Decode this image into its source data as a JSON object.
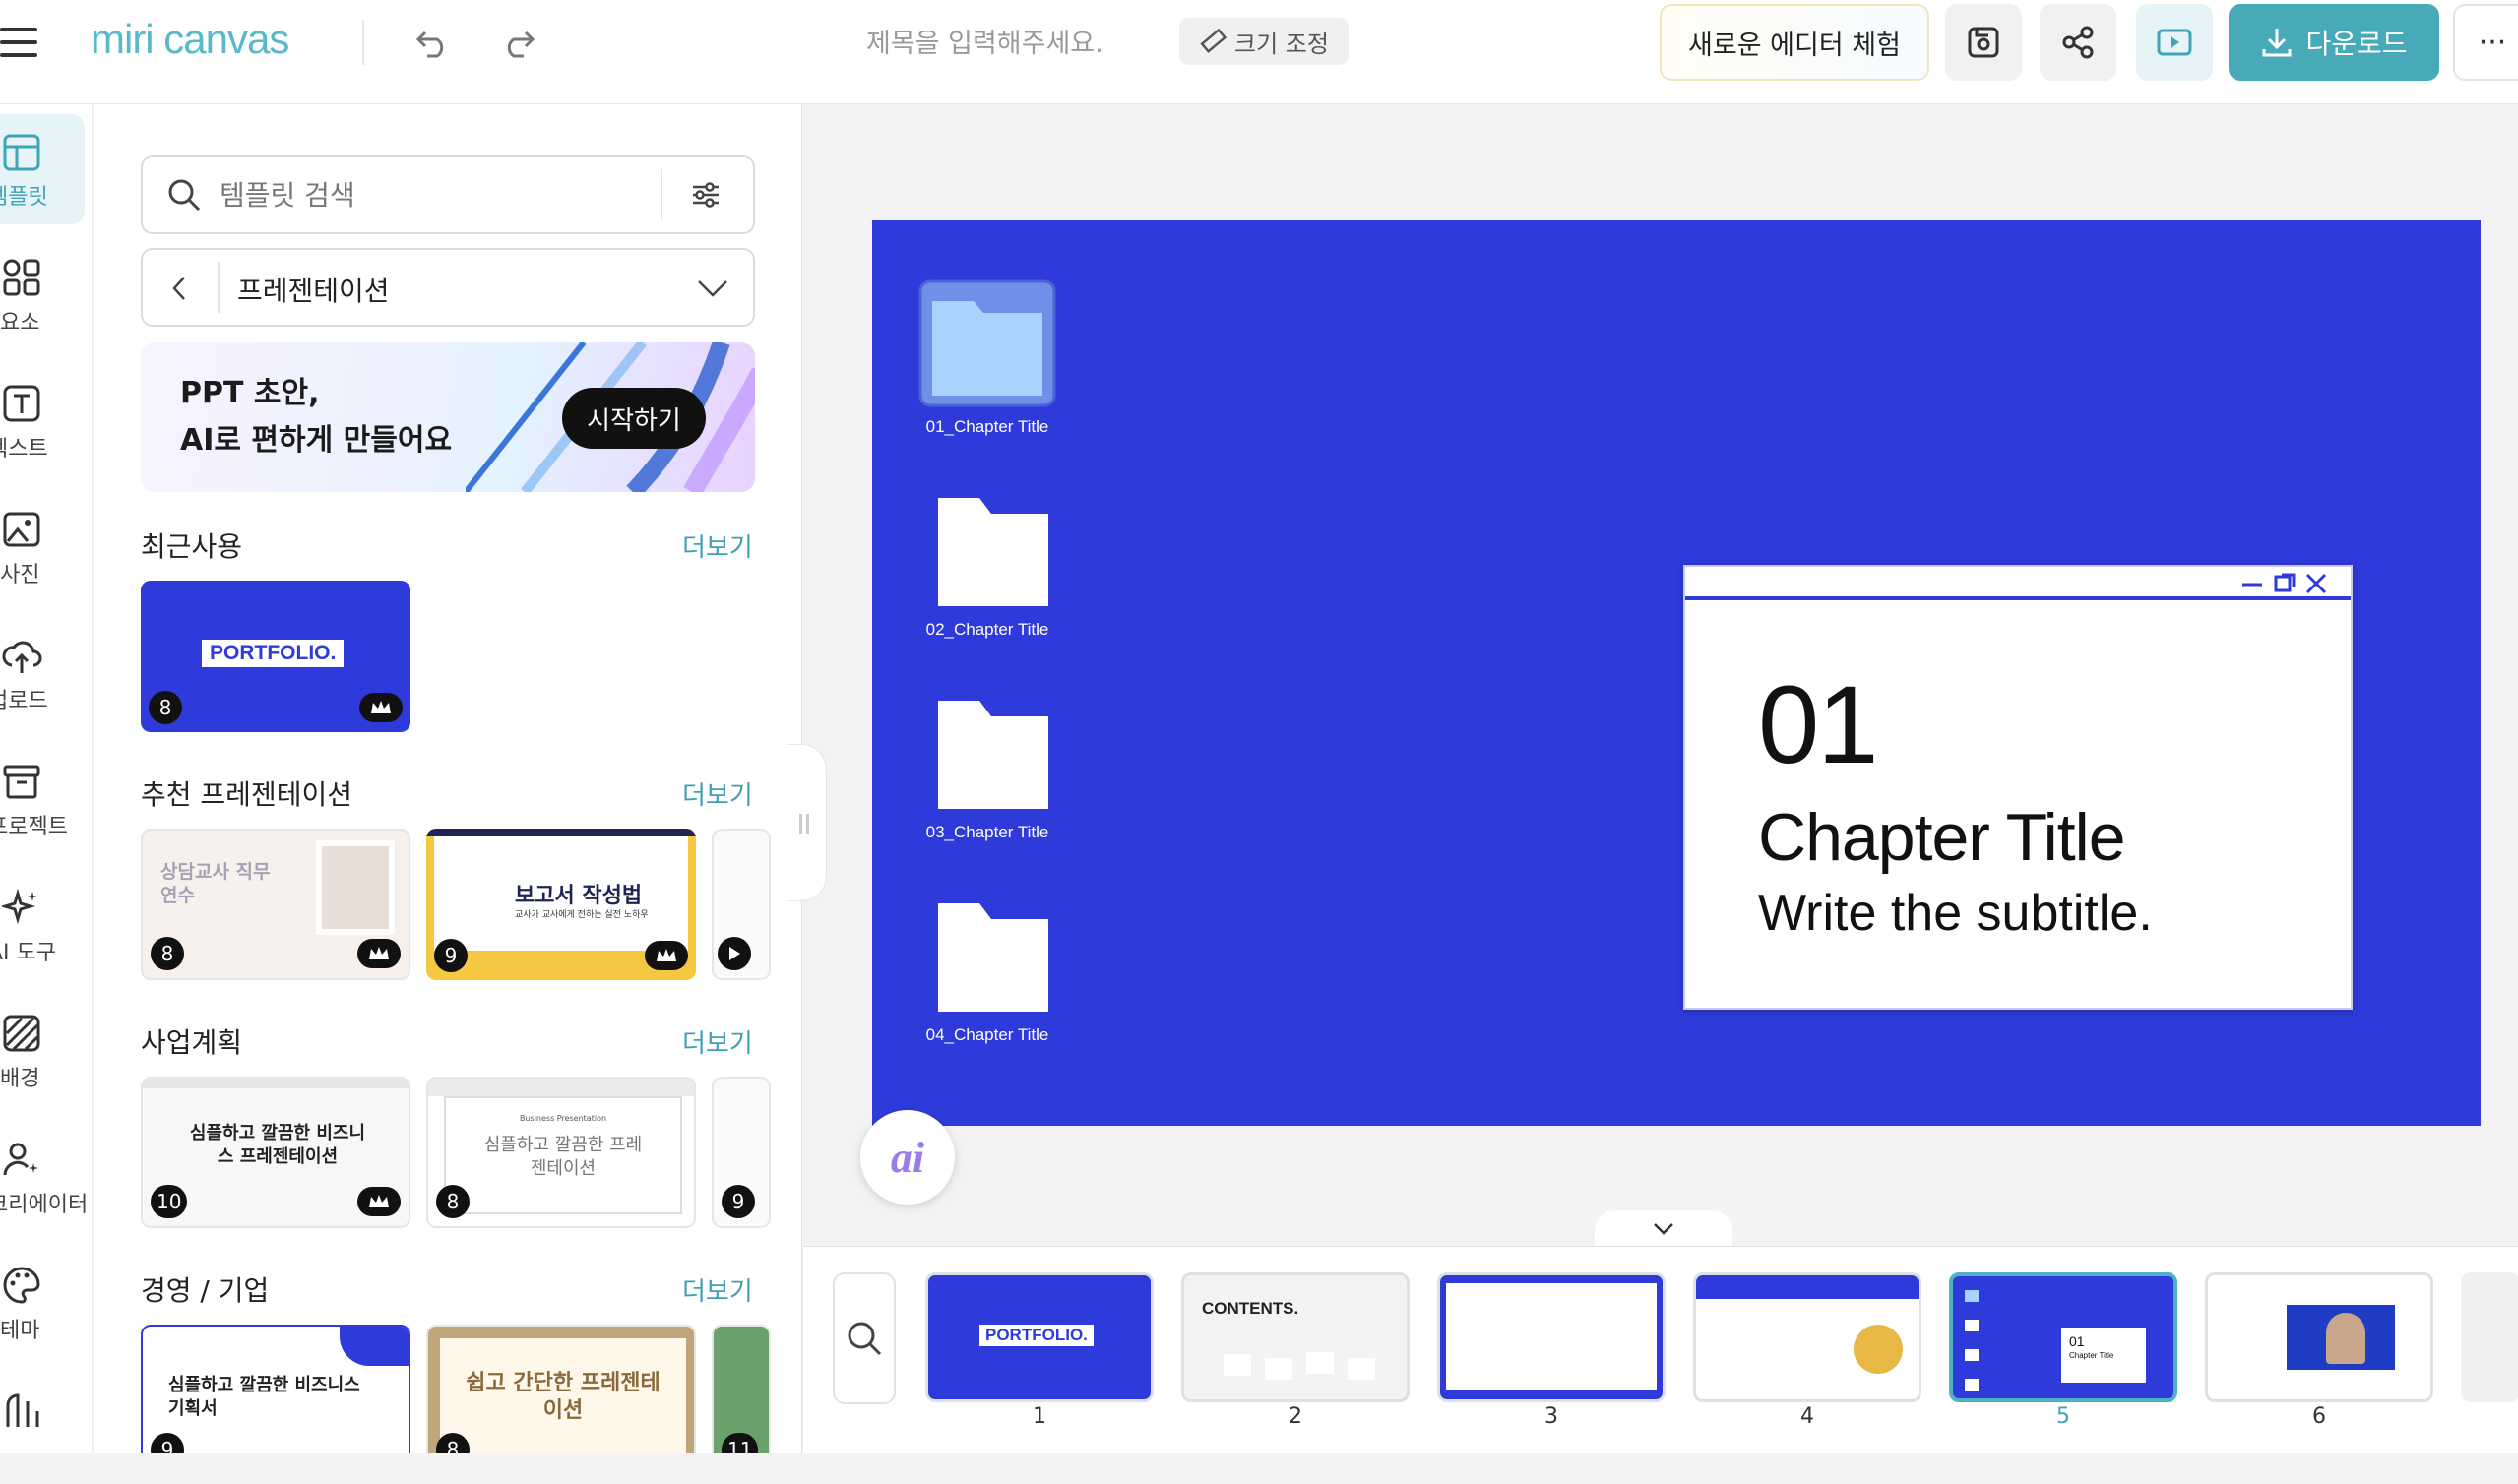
{
  "app": {
    "logo": "miri canvas",
    "title_placeholder": "제목을 입력해주세요.",
    "resize_label": "크기 조정",
    "new_editor_label": "새로운 에디터 체험",
    "download_label": "다운로드",
    "more_label": "···"
  },
  "rail": {
    "items": [
      {
        "label": "템플릿",
        "icon": "template-icon"
      },
      {
        "label": "요소",
        "icon": "elements-icon"
      },
      {
        "label": "텍스트",
        "icon": "text-icon"
      },
      {
        "label": "사진",
        "icon": "photo-icon"
      },
      {
        "label": "업로드",
        "icon": "upload-icon"
      },
      {
        "label": "프로젝트",
        "icon": "project-icon"
      },
      {
        "label": "AI 도구",
        "icon": "ai-tools-icon"
      },
      {
        "label": "배경",
        "icon": "background-icon"
      },
      {
        "label": "크리에이터",
        "icon": "creator-icon"
      },
      {
        "label": "테마",
        "icon": "theme-icon"
      },
      {
        "label": "",
        "icon": "chart-icon"
      }
    ]
  },
  "panel": {
    "search_placeholder": "템플릿 검색",
    "category": "프레젠테이션",
    "banner": {
      "line1": "PPT 초안,",
      "line2": "AI로 편하게 만들어요",
      "cta": "시작하기"
    },
    "more_label": "더보기",
    "sections": [
      {
        "title": "최근사용",
        "thumbs": [
          {
            "text": "PORTFOLIO.",
            "count": "8"
          }
        ]
      },
      {
        "title": "추천 프레젠테이션",
        "thumbs": [
          {
            "text": "상담교사 직무연수",
            "count": "8"
          },
          {
            "text": "보고서 작성법",
            "sub": "교사가 교사에게 전하는 실전 노하우",
            "count": "9"
          }
        ]
      },
      {
        "title": "사업계획",
        "thumbs": [
          {
            "text": "심플하고 깔끔한 비즈니스 프레젠테이션",
            "count": "10"
          },
          {
            "text": "심플하고 깔끔한 프레젠테이션",
            "kicker": "Business Presentation",
            "count": "8"
          },
          {
            "text": "",
            "count": "9"
          }
        ]
      },
      {
        "title": "경영 / 기업",
        "thumbs": [
          {
            "text": "심플하고 깔끔한 비즈니스 기획서",
            "count": "9"
          },
          {
            "text": "쉽고 간단한 프레젠테이션",
            "count": "8"
          },
          {
            "text": "",
            "count": "11"
          }
        ]
      }
    ]
  },
  "canvas": {
    "background": "#2f3adb",
    "folders": [
      "01_Chapter Title",
      "02_Chapter Title",
      "03_Chapter Title",
      "04_Chapter Title"
    ],
    "window": {
      "number": "01",
      "title": "Chapter Title",
      "subtitle": "Write the subtitle."
    },
    "ai_label": "ai"
  },
  "filmstrip": {
    "slides": [
      {
        "num": "1",
        "text": "PORTFOLIO."
      },
      {
        "num": "2",
        "text": "CONTENTS."
      },
      {
        "num": "3",
        "text": ""
      },
      {
        "num": "4",
        "text": ""
      },
      {
        "num": "5",
        "text": "01",
        "sub": "Chapter Title",
        "selected": true
      },
      {
        "num": "6",
        "text": ""
      }
    ]
  }
}
